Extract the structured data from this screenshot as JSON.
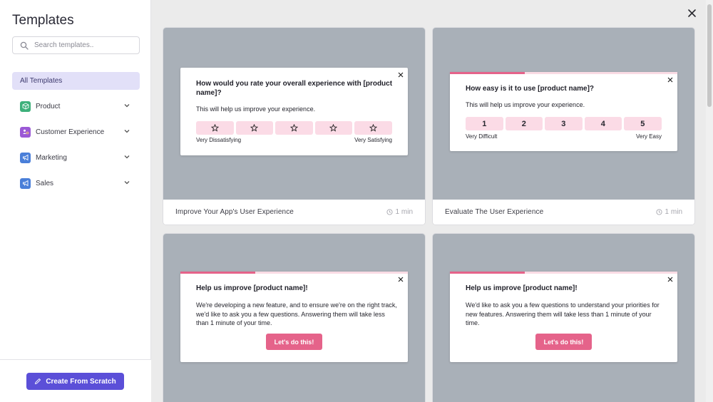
{
  "sidebar": {
    "title": "Templates",
    "search_placeholder": "Search templates..",
    "all_label": "All Templates",
    "items": [
      {
        "label": "Product",
        "icon": "cube-icon",
        "color": "#3db07a"
      },
      {
        "label": "Customer Experience",
        "icon": "user-icon",
        "color": "#9b59d6"
      },
      {
        "label": "Marketing",
        "icon": "megaphone-icon",
        "color": "#4a7fd9"
      },
      {
        "label": "Sales",
        "icon": "megaphone-icon",
        "color": "#4a7fd9"
      }
    ],
    "create_label": "Create From Scratch"
  },
  "colors": {
    "accent": "#5b4fd8",
    "pink": "#e5638a",
    "pink_light": "#fbdbe6",
    "preview_bg": "#a9b0b8"
  },
  "cards": [
    {
      "name": "Improve Your App's User Experience",
      "time": "1 min",
      "modal": {
        "question": "How would you rate your overall experience with [product name]?",
        "subtitle": "This will help us improve your experience.",
        "low_label": "Very Dissatisfying",
        "high_label": "Very Satisfying"
      }
    },
    {
      "name": "Evaluate The User Experience",
      "time": "1 min",
      "modal": {
        "question": "How easy is it to use [product name]?",
        "subtitle": "This will help us improve your experience.",
        "scale": [
          "1",
          "2",
          "3",
          "4",
          "5"
        ],
        "low_label": "Very Difficult",
        "high_label": "Very Easy",
        "progress": 0.33
      }
    },
    {
      "modal": {
        "question": "Help us improve [product name]!",
        "body": "We're developing a new feature, and to ensure we're on the right track, we'd like to ask you a few questions. Answering them will take less than 1 minute of your time.",
        "cta": "Let's do this!",
        "progress": 0.33
      }
    },
    {
      "modal": {
        "question": "Help us improve [product name]!",
        "body": "We'd like to ask you a few questions to understand your priorities for new features. Answering them will take less than 1 minute of your time.",
        "cta": "Let's do this!",
        "progress": 0.33
      }
    }
  ]
}
